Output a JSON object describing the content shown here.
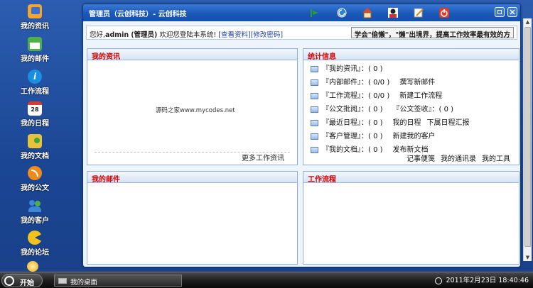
{
  "sidebar": {
    "items": [
      {
        "label": "我的资讯",
        "icon": "news-icon",
        "color": "#f2a531"
      },
      {
        "label": "我的邮件",
        "icon": "mail-icon",
        "color": "#4fb04a"
      },
      {
        "label": "工作流程",
        "icon": "info-icon",
        "color": "#1a8ee0"
      },
      {
        "label": "我的日程",
        "icon": "calendar-icon",
        "color": "#d53c2e"
      },
      {
        "label": "我的文档",
        "icon": "document-icon",
        "color": "#e8c23a"
      },
      {
        "label": "我的公文",
        "icon": "rss-icon",
        "color": "#f08a1a"
      },
      {
        "label": "我的客户",
        "icon": "users-icon",
        "color": "#3b86d6"
      },
      {
        "label": "我的论坛",
        "icon": "forum-icon",
        "color": "#f2c11c"
      }
    ]
  },
  "window": {
    "title": "管理员（云创科技）- 云创科技",
    "toolbar_icons": [
      "exit-icon",
      "refresh-icon",
      "home-icon",
      "user-icon",
      "edit-icon",
      "power-icon"
    ]
  },
  "info": {
    "greeting_prefix": "您好,",
    "user": "admin",
    "role": "(管理员)",
    "welcome": "欢迎您登陆本系统!",
    "view_profile": "[查看资料]",
    "change_password": "[修改密码]",
    "slogan": "学会\"偷懒\"，\"懒\"出境界，提高工作效率最有效的方"
  },
  "panels": {
    "news": {
      "title": "我的资讯",
      "watermark": "源码之家www.mycodes.net",
      "more": "更多工作资讯"
    },
    "stats": {
      "title": "统计信息",
      "rows": [
        {
          "label": "『我的资讯』：( 0 )",
          "links": []
        },
        {
          "label": "『内部邮件』：( 0/0 )",
          "links": [
            "撰写新邮件"
          ]
        },
        {
          "label": "『工作流程』：( 0/0 )",
          "links": [
            "新建工作流程"
          ]
        },
        {
          "label": "『公文批阅』：( 0 )",
          "links": [
            "『公文签收』：( 0 )"
          ]
        },
        {
          "label": "『最近日程』：( 0 )",
          "links": [
            "我的日程",
            "下属日程汇报"
          ]
        },
        {
          "label": "『客户管理』：( 0 )",
          "links": [
            "新建我的客户"
          ]
        },
        {
          "label": "『我的文档』：( 0 )",
          "links": [
            "发布新文档"
          ]
        }
      ],
      "footer_links": [
        "记事便笺",
        "我的通讯录",
        "我的工具"
      ]
    },
    "mail": {
      "title": "我的邮件"
    },
    "workflow": {
      "title": "工作流程"
    }
  },
  "taskbar": {
    "start": "开始",
    "task": "我的桌面",
    "datetime": "2011年2月23日  18:40:46"
  }
}
